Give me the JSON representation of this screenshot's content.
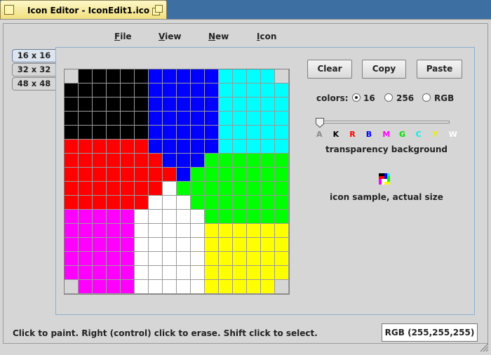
{
  "window": {
    "title": "Icon Editor - IconEdit1.ico"
  },
  "menu": {
    "items": [
      {
        "accel": "F",
        "rest": "ile"
      },
      {
        "accel": "V",
        "rest": "iew"
      },
      {
        "accel": "N",
        "rest": "ew"
      },
      {
        "accel": "I",
        "rest": "con"
      }
    ]
  },
  "tabs": [
    "16 x 16",
    "32 x 32",
    "48 x 48"
  ],
  "selected_tab": "16 x 16",
  "buttons": {
    "clear": "Clear",
    "copy": "Copy",
    "paste": "Paste"
  },
  "colors": {
    "label": "colors:",
    "options": [
      "16",
      "256",
      "RGB"
    ],
    "selected": "16"
  },
  "transparency": {
    "letters": [
      "A",
      "K",
      "R",
      "B",
      "M",
      "G",
      "C",
      "Y",
      "W"
    ],
    "letter_colors": [
      "#8a8a8a",
      "#000000",
      "#ff0000",
      "#0000ff",
      "#ff00ff",
      "#00dd00",
      "#00eeee",
      "#eeee00",
      "#ffffff"
    ],
    "selected": "A",
    "caption": "transparency background"
  },
  "sample_caption": "icon sample, actual size",
  "status_text": "Click to paint.  Right (control) click to erase.  Shift click to select.",
  "rgb_readout": "RGB (255,255,255)",
  "palette": {
    ".": "transparent",
    "K": "#000000",
    "B": "#0000ff",
    "C": "#00ffff",
    "R": "#ff0000",
    "G": "#00ff00",
    "M": "#ff00ff",
    "W": "#ffffff",
    "Y": "#ffff00"
  },
  "icon_pixels": [
    ".KKKKKBBBBBCCCC.",
    "KKKKKKBBBBBCCCCC",
    "KKKKKKBBBBBCCCCC",
    "KKKKKKBBBBBCCCCC",
    "KKKKKKBBBBBCCCCC",
    "RRRRRRBBBBBCCCCC",
    "RRRRRRRBBBGGGGGG",
    "RRRRRRRRBGGGGGGG",
    "RRRRRRRWGGGGGGGG",
    "RRRRRRWWWGGGGGGG",
    "MMMMMWWWWWGGGGGG",
    "MMMMMWWWWWYYYYYY",
    "MMMMMWWWWWYYYYYY",
    "MMMMMWWWWWYYYYYY",
    "MMMMMWWWWWYYYYYY",
    ".MMMMWWWWWYYYYY."
  ],
  "sample_pixels": [
    "KKBC",
    "RRBG",
    "MWWG",
    "MWYY"
  ]
}
